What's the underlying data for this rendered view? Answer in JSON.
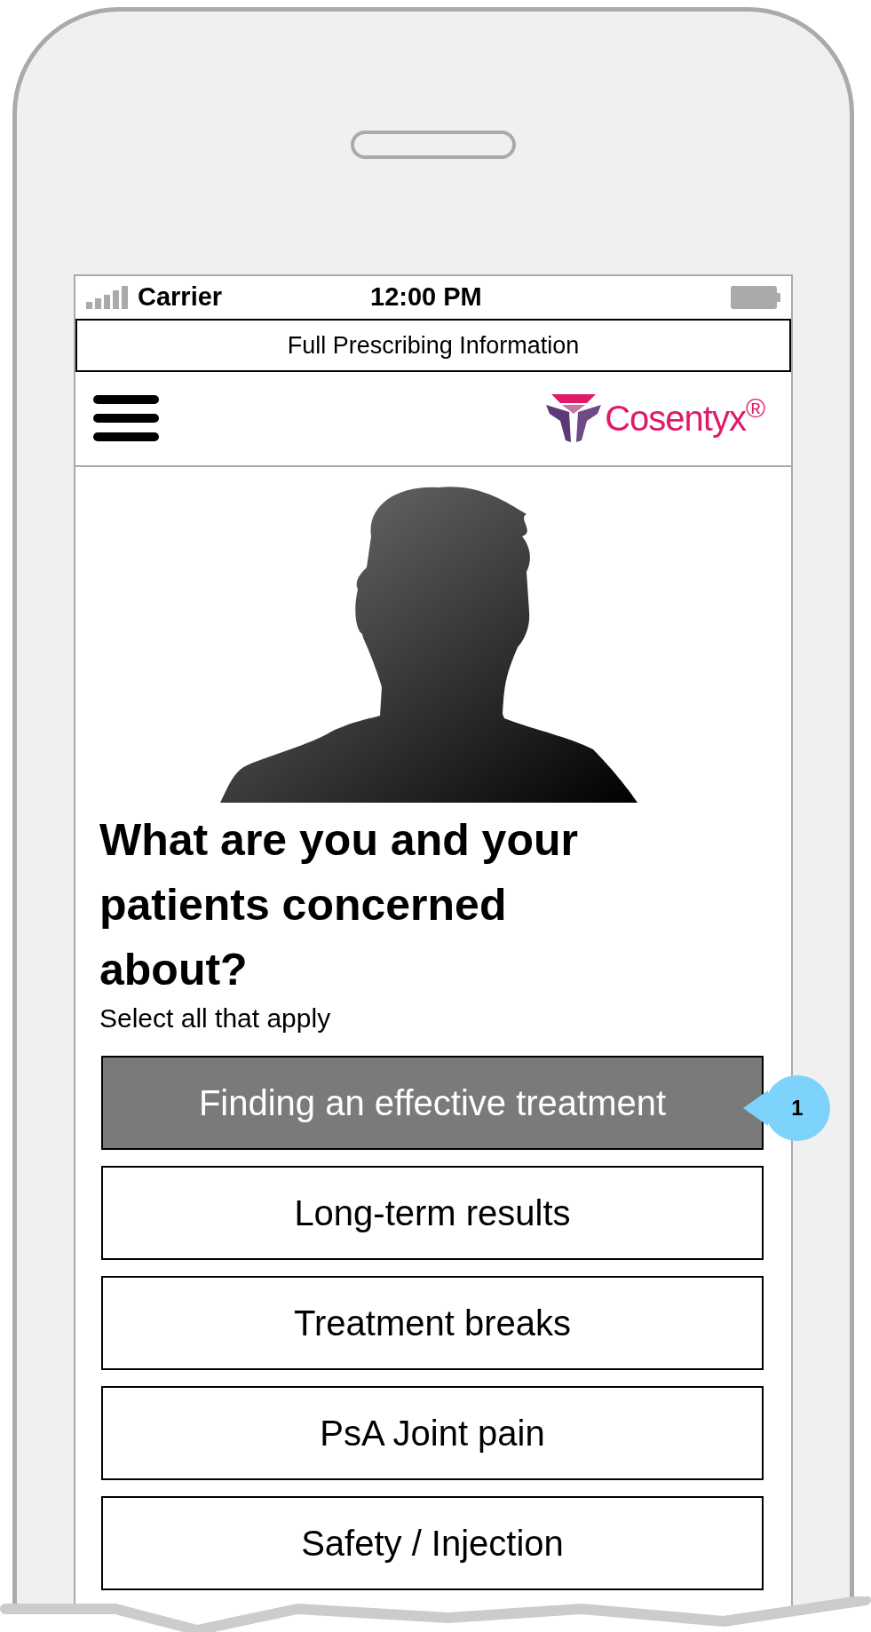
{
  "status_bar": {
    "carrier": "Carrier",
    "time": "12:00 PM"
  },
  "banner": {
    "label": "Full Prescribing Information"
  },
  "header": {
    "logo_text": "Cosentyx$^{®}$"
  },
  "heading": "What are you and your patients concerned about?",
  "subheading": "Select all that apply",
  "options": [
    {
      "label": "Finding an effective treatment",
      "selected": true
    },
    {
      "label": "Long-term results",
      "selected": false
    },
    {
      "label": "Treatment breaks",
      "selected": false
    },
    {
      "label": "PsA Joint pain",
      "selected": false
    },
    {
      "label": "Safety / Injection",
      "selected": false
    }
  ],
  "callout": {
    "number": "1"
  }
}
